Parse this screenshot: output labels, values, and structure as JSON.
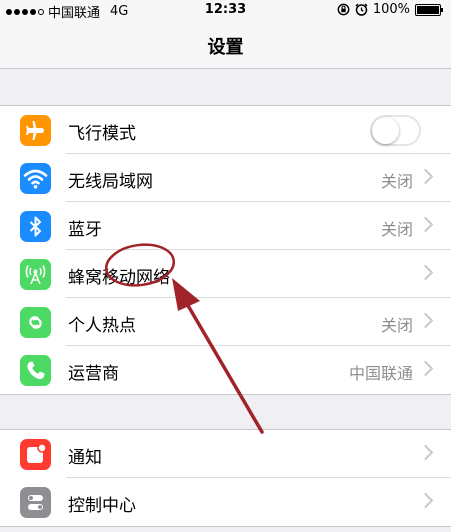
{
  "status_bar": {
    "carrier": "中国联通",
    "network": "4G",
    "time": "12:33",
    "battery": "100%",
    "signal_bars_filled": 4,
    "signal_bars_total": 5
  },
  "nav": {
    "title": "设置"
  },
  "colors": {
    "airplane": "#ff9500",
    "wifi": "#1a8cff",
    "bluetooth": "#1a8cff",
    "cellular": "#4cd964",
    "hotspot": "#4cd964",
    "carrier": "#4cd964",
    "notifications": "#ff3b30",
    "control_center": "#8e8e93",
    "annotation": "#a0232a"
  },
  "group1": {
    "airplane": {
      "label": "飞行模式",
      "icon": "airplane-icon",
      "toggle_on": false
    },
    "wifi": {
      "label": "无线局域网",
      "value": "关闭",
      "icon": "wifi-icon"
    },
    "bluetooth": {
      "label": "蓝牙",
      "value": "关闭",
      "icon": "bluetooth-icon"
    },
    "cellular": {
      "label": "蜂窝移动网络",
      "icon": "cellular-antenna-icon"
    },
    "hotspot": {
      "label": "个人热点",
      "value": "关闭",
      "icon": "hotspot-icon"
    },
    "carrier": {
      "label": "运营商",
      "value": "中国联通",
      "icon": "phone-icon"
    }
  },
  "group2": {
    "notifications": {
      "label": "通知",
      "icon": "notifications-icon"
    },
    "control_center": {
      "label": "控制中心",
      "icon": "control-center-icon"
    }
  }
}
